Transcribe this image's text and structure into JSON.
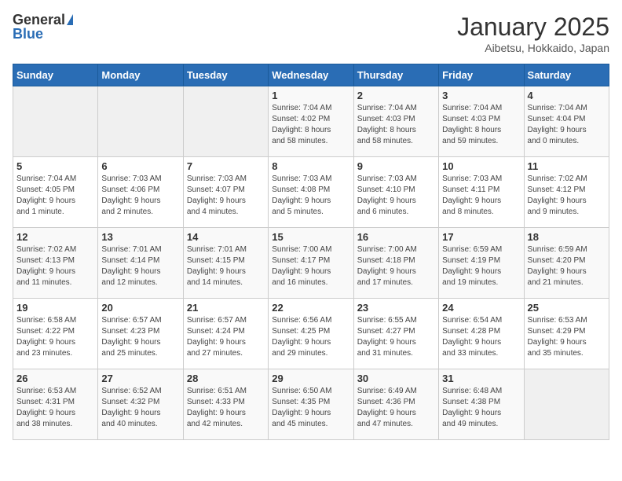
{
  "logo": {
    "general": "General",
    "blue": "Blue"
  },
  "header": {
    "month": "January 2025",
    "location": "Aibetsu, Hokkaido, Japan"
  },
  "days_header": [
    "Sunday",
    "Monday",
    "Tuesday",
    "Wednesday",
    "Thursday",
    "Friday",
    "Saturday"
  ],
  "weeks": [
    [
      {
        "day": "",
        "info": ""
      },
      {
        "day": "",
        "info": ""
      },
      {
        "day": "",
        "info": ""
      },
      {
        "day": "1",
        "info": "Sunrise: 7:04 AM\nSunset: 4:02 PM\nDaylight: 8 hours\nand 58 minutes."
      },
      {
        "day": "2",
        "info": "Sunrise: 7:04 AM\nSunset: 4:03 PM\nDaylight: 8 hours\nand 58 minutes."
      },
      {
        "day": "3",
        "info": "Sunrise: 7:04 AM\nSunset: 4:03 PM\nDaylight: 8 hours\nand 59 minutes."
      },
      {
        "day": "4",
        "info": "Sunrise: 7:04 AM\nSunset: 4:04 PM\nDaylight: 9 hours\nand 0 minutes."
      }
    ],
    [
      {
        "day": "5",
        "info": "Sunrise: 7:04 AM\nSunset: 4:05 PM\nDaylight: 9 hours\nand 1 minute."
      },
      {
        "day": "6",
        "info": "Sunrise: 7:03 AM\nSunset: 4:06 PM\nDaylight: 9 hours\nand 2 minutes."
      },
      {
        "day": "7",
        "info": "Sunrise: 7:03 AM\nSunset: 4:07 PM\nDaylight: 9 hours\nand 4 minutes."
      },
      {
        "day": "8",
        "info": "Sunrise: 7:03 AM\nSunset: 4:08 PM\nDaylight: 9 hours\nand 5 minutes."
      },
      {
        "day": "9",
        "info": "Sunrise: 7:03 AM\nSunset: 4:10 PM\nDaylight: 9 hours\nand 6 minutes."
      },
      {
        "day": "10",
        "info": "Sunrise: 7:03 AM\nSunset: 4:11 PM\nDaylight: 9 hours\nand 8 minutes."
      },
      {
        "day": "11",
        "info": "Sunrise: 7:02 AM\nSunset: 4:12 PM\nDaylight: 9 hours\nand 9 minutes."
      }
    ],
    [
      {
        "day": "12",
        "info": "Sunrise: 7:02 AM\nSunset: 4:13 PM\nDaylight: 9 hours\nand 11 minutes."
      },
      {
        "day": "13",
        "info": "Sunrise: 7:01 AM\nSunset: 4:14 PM\nDaylight: 9 hours\nand 12 minutes."
      },
      {
        "day": "14",
        "info": "Sunrise: 7:01 AM\nSunset: 4:15 PM\nDaylight: 9 hours\nand 14 minutes."
      },
      {
        "day": "15",
        "info": "Sunrise: 7:00 AM\nSunset: 4:17 PM\nDaylight: 9 hours\nand 16 minutes."
      },
      {
        "day": "16",
        "info": "Sunrise: 7:00 AM\nSunset: 4:18 PM\nDaylight: 9 hours\nand 17 minutes."
      },
      {
        "day": "17",
        "info": "Sunrise: 6:59 AM\nSunset: 4:19 PM\nDaylight: 9 hours\nand 19 minutes."
      },
      {
        "day": "18",
        "info": "Sunrise: 6:59 AM\nSunset: 4:20 PM\nDaylight: 9 hours\nand 21 minutes."
      }
    ],
    [
      {
        "day": "19",
        "info": "Sunrise: 6:58 AM\nSunset: 4:22 PM\nDaylight: 9 hours\nand 23 minutes."
      },
      {
        "day": "20",
        "info": "Sunrise: 6:57 AM\nSunset: 4:23 PM\nDaylight: 9 hours\nand 25 minutes."
      },
      {
        "day": "21",
        "info": "Sunrise: 6:57 AM\nSunset: 4:24 PM\nDaylight: 9 hours\nand 27 minutes."
      },
      {
        "day": "22",
        "info": "Sunrise: 6:56 AM\nSunset: 4:25 PM\nDaylight: 9 hours\nand 29 minutes."
      },
      {
        "day": "23",
        "info": "Sunrise: 6:55 AM\nSunset: 4:27 PM\nDaylight: 9 hours\nand 31 minutes."
      },
      {
        "day": "24",
        "info": "Sunrise: 6:54 AM\nSunset: 4:28 PM\nDaylight: 9 hours\nand 33 minutes."
      },
      {
        "day": "25",
        "info": "Sunrise: 6:53 AM\nSunset: 4:29 PM\nDaylight: 9 hours\nand 35 minutes."
      }
    ],
    [
      {
        "day": "26",
        "info": "Sunrise: 6:53 AM\nSunset: 4:31 PM\nDaylight: 9 hours\nand 38 minutes."
      },
      {
        "day": "27",
        "info": "Sunrise: 6:52 AM\nSunset: 4:32 PM\nDaylight: 9 hours\nand 40 minutes."
      },
      {
        "day": "28",
        "info": "Sunrise: 6:51 AM\nSunset: 4:33 PM\nDaylight: 9 hours\nand 42 minutes."
      },
      {
        "day": "29",
        "info": "Sunrise: 6:50 AM\nSunset: 4:35 PM\nDaylight: 9 hours\nand 45 minutes."
      },
      {
        "day": "30",
        "info": "Sunrise: 6:49 AM\nSunset: 4:36 PM\nDaylight: 9 hours\nand 47 minutes."
      },
      {
        "day": "31",
        "info": "Sunrise: 6:48 AM\nSunset: 4:38 PM\nDaylight: 9 hours\nand 49 minutes."
      },
      {
        "day": "",
        "info": ""
      }
    ]
  ]
}
